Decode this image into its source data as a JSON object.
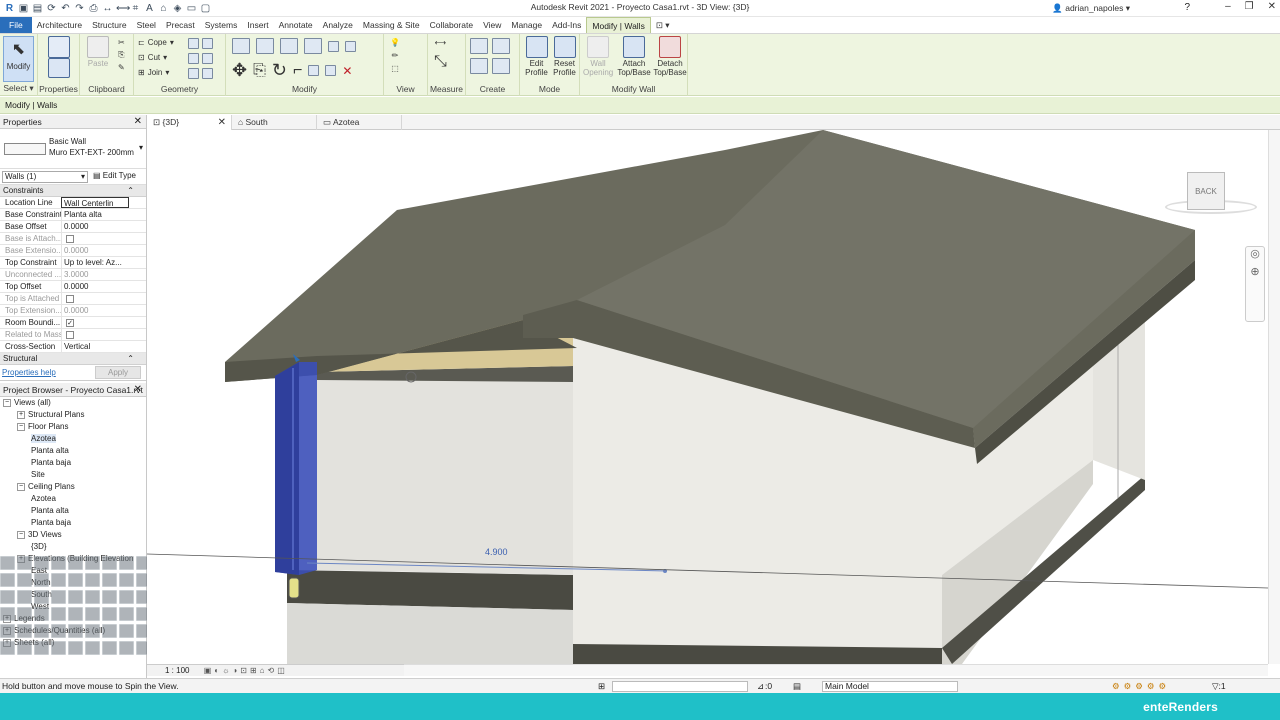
{
  "app_title": "Autodesk Revit 2021 - Proyecto Casa1.rvt - 3D View: {3D}",
  "user": "adrian_napoles",
  "tabs": [
    "File",
    "Architecture",
    "Structure",
    "Steel",
    "Precast",
    "Systems",
    "Insert",
    "Annotate",
    "Analyze",
    "Massing & Site",
    "Collaborate",
    "View",
    "Manage",
    "Add-Ins",
    "Modify | Walls"
  ],
  "ribbon": {
    "modify_label": "Modify",
    "select_panel": "Select",
    "properties_panel": "Properties",
    "paste_label": "Paste",
    "clipboard_panel": "Clipboard",
    "cope_label": "Cope",
    "cut_label": "Cut",
    "join_label": "Join",
    "geometry_panel": "Geometry",
    "modify_panel": "Modify",
    "view_panel": "View",
    "measure_panel": "Measure",
    "create_panel": "Create",
    "edit_profile": "Edit Profile",
    "reset_profile": "Reset Profile",
    "mode_panel": "Mode",
    "wall_opening": "Wall Opening",
    "attach_topbase": "Attach Top/Base",
    "detach_topbase": "Detach Top/Base",
    "modifywall_panel": "Modify Wall"
  },
  "context_bar": "Modify | Walls",
  "properties": {
    "title": "Properties",
    "type_family": "Basic Wall",
    "type_name": "Muro EXT-EXT- 200mm",
    "selector": "Walls (1)",
    "edit_type": "Edit Type",
    "section_constraints": "Constraints",
    "rows": [
      {
        "k": "Location Line",
        "v": "Wall Centerlin",
        "dim": false
      },
      {
        "k": "Base Constraint",
        "v": "Planta alta",
        "dim": false
      },
      {
        "k": "Base Offset",
        "v": "0.0000",
        "dim": false
      },
      {
        "k": "Base is Attach...",
        "v": "",
        "dim": true
      },
      {
        "k": "Base Extensio...",
        "v": "0.0000",
        "dim": true
      },
      {
        "k": "Top Constraint",
        "v": "Up to level: Az...",
        "dim": false
      },
      {
        "k": "Unconnected ...",
        "v": "3.0000",
        "dim": true
      },
      {
        "k": "Top Offset",
        "v": "0.0000",
        "dim": false
      },
      {
        "k": "Top is Attached",
        "v": "",
        "dim": true
      },
      {
        "k": "Top Extension...",
        "v": "0.0000",
        "dim": true
      },
      {
        "k": "Room Boundi...",
        "v": "",
        "dim": false
      },
      {
        "k": "Related to Mass",
        "v": "",
        "dim": true
      },
      {
        "k": "Cross-Section",
        "v": "Vertical",
        "dim": false
      }
    ],
    "section_structural": "Structural",
    "help_link": "Properties help",
    "apply": "Apply"
  },
  "browser": {
    "title": "Project Browser - Proyecto Casa1.rvt",
    "nodes": [
      {
        "label": "Views (all)",
        "level": 0
      },
      {
        "label": "Structural Plans",
        "level": 1
      },
      {
        "label": "Floor Plans",
        "level": 1
      },
      {
        "label": "Azotea",
        "level": 2
      },
      {
        "label": "Planta alta",
        "level": 2
      },
      {
        "label": "Planta baja",
        "level": 2
      },
      {
        "label": "Site",
        "level": 2
      },
      {
        "label": "Ceiling Plans",
        "level": 1
      },
      {
        "label": "Azotea",
        "level": 2
      },
      {
        "label": "Planta alta",
        "level": 2
      },
      {
        "label": "Planta baja",
        "level": 2
      },
      {
        "label": "3D Views",
        "level": 1
      },
      {
        "label": "{3D}",
        "level": 2
      },
      {
        "label": "Elevations (Building Elevation",
        "level": 1
      },
      {
        "label": "East",
        "level": 2
      },
      {
        "label": "North",
        "level": 2
      },
      {
        "label": "South",
        "level": 2
      },
      {
        "label": "West",
        "level": 2
      },
      {
        "label": "Legends",
        "level": 0
      },
      {
        "label": "Schedules/Quantities (all)",
        "level": 0
      },
      {
        "label": "Sheets (all)",
        "level": 0
      }
    ]
  },
  "view_tabs": [
    {
      "label": "{3D}",
      "active": true
    },
    {
      "label": "South",
      "active": false
    },
    {
      "label": "Azotea",
      "active": false
    }
  ],
  "viewcube_label": "BACK",
  "dimension_text": "4.900",
  "scale_text": "1 : 100",
  "status_text": "Hold button and move mouse to Spin the View.",
  "model_selector": "Main Model",
  "status_zero": ":0",
  "brand": "enteRenders",
  "colors": {
    "accent": "#2a6ebb",
    "ribbon": "#eef5e0",
    "footer": "#1fc0c8",
    "wall_selected": "#3b4fb8",
    "roof": "#6b6b5e"
  }
}
